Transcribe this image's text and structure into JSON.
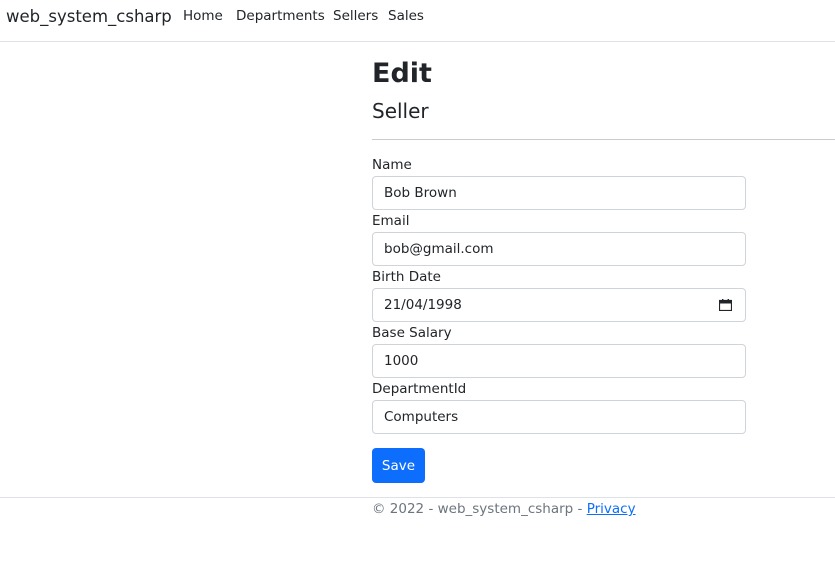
{
  "navbar": {
    "brand": "web_system_csharp",
    "links": [
      "Home",
      "Departments",
      "Sellers",
      "Sales"
    ]
  },
  "page": {
    "title": "Edit",
    "subtitle": "Seller"
  },
  "form": {
    "fields": [
      {
        "label": "Name",
        "value": "Bob Brown"
      },
      {
        "label": "Email",
        "value": "bob@gmail.com"
      },
      {
        "label": "Birth Date",
        "value": "21/04/1998"
      },
      {
        "label": "Base Salary",
        "value": "1000"
      },
      {
        "label": "DepartmentId",
        "value": "Computers"
      }
    ],
    "save_label": "Save"
  },
  "footer": {
    "text": "© 2022 - web_system_csharp - ",
    "privacy_link": "Privacy"
  },
  "colors": {
    "primary": "#0d6efd",
    "border": "#ced4da",
    "footer_text": "#6c757d"
  },
  "icons": {
    "date_picker": "calendar-icon"
  }
}
